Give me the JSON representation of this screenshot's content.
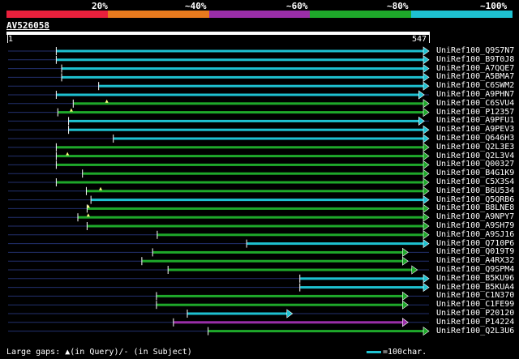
{
  "legend": {
    "segments": [
      "#e8203c",
      "#e87a1e",
      "#9a2ea8",
      "#1ea82a",
      "#1ec1d1"
    ],
    "labels": [
      "20%",
      "~40%",
      "~60%",
      "~80%",
      "~100%"
    ]
  },
  "query": {
    "id": "AV526058",
    "start": "1",
    "end": "547"
  },
  "colors": {
    "green": "#1ea82a",
    "cyan": "#1ec1d1",
    "purple": "#9a2ea8",
    "dim_line": "#23306e",
    "gap_line": "#1e6a86"
  },
  "hits": [
    {
      "name": "UniRef100_Q9S7N7",
      "start": 64,
      "end": 547,
      "color": "cyan"
    },
    {
      "name": "UniRef100_B9T0J8",
      "start": 64,
      "end": 547,
      "color": "cyan"
    },
    {
      "name": "UniRef100_A7QQE7",
      "start": 71,
      "end": 547,
      "color": "cyan"
    },
    {
      "name": "UniRef100_A5BMA7",
      "start": 71,
      "end": 547,
      "color": "cyan"
    },
    {
      "name": "UniRef100_C6SWM2",
      "start": 119,
      "end": 547,
      "color": "cyan"
    },
    {
      "name": "UniRef100_A9PHN7",
      "start": 64,
      "end": 541,
      "color": "cyan"
    },
    {
      "name": "UniRef100_C6SVU4",
      "start": 86,
      "end": 547,
      "color": "green",
      "gap": 129
    },
    {
      "name": "UniRef100_P12357",
      "start": 66,
      "end": 547,
      "color": "green",
      "gap": 83
    },
    {
      "name": "UniRef100_A9PFU1",
      "start": 80,
      "end": 541,
      "color": "cyan"
    },
    {
      "name": "UniRef100_A9PEV3",
      "start": 80,
      "end": 547,
      "color": "cyan"
    },
    {
      "name": "UniRef100_Q646H3",
      "start": 138,
      "end": 547,
      "color": "cyan"
    },
    {
      "name": "UniRef100_Q2L3E3",
      "start": 64,
      "end": 547,
      "color": "green"
    },
    {
      "name": "UniRef100_Q2L3V4",
      "start": 64,
      "end": 547,
      "color": "green",
      "gap": 78
    },
    {
      "name": "UniRef100_Q00327",
      "start": 64,
      "end": 547,
      "color": "green"
    },
    {
      "name": "UniRef100_B4G1K9",
      "start": 98,
      "end": 547,
      "color": "green"
    },
    {
      "name": "UniRef100_C5X3S4",
      "start": 64,
      "end": 547,
      "color": "green"
    },
    {
      "name": "UniRef100_B6U534",
      "start": 103,
      "end": 547,
      "color": "green",
      "gap": 121
    },
    {
      "name": "UniRef100_Q5QRB6",
      "start": 109,
      "end": 547,
      "color": "cyan"
    },
    {
      "name": "UniRef100_B8LNE8",
      "start": 104,
      "end": 547,
      "color": "green",
      "gap": 105
    },
    {
      "name": "UniRef100_A9NPY7",
      "start": 92,
      "end": 547,
      "color": "green",
      "gap": 105
    },
    {
      "name": "UniRef100_A9SH79",
      "start": 104,
      "end": 547,
      "color": "green"
    },
    {
      "name": "UniRef100_A9SJ16",
      "start": 195,
      "end": 547,
      "color": "green"
    },
    {
      "name": "UniRef100_Q710P6",
      "start": 311,
      "end": 547,
      "color": "cyan"
    },
    {
      "name": "UniRef100_Q019T9",
      "start": 189,
      "end": 520,
      "color": "green"
    },
    {
      "name": "UniRef100_A4RX32",
      "start": 175,
      "end": 520,
      "color": "green"
    },
    {
      "name": "UniRef100_Q9SPM4",
      "start": 209,
      "end": 532,
      "color": "green"
    },
    {
      "name": "UniRef100_B5KU96",
      "start": 380,
      "end": 547,
      "color": "cyan"
    },
    {
      "name": "UniRef100_B5KUA4",
      "start": 380,
      "end": 547,
      "color": "cyan"
    },
    {
      "name": "UniRef100_C1N370",
      "start": 194,
      "end": 520,
      "color": "green"
    },
    {
      "name": "UniRef100_C1FE99",
      "start": 194,
      "end": 520,
      "color": "green"
    },
    {
      "name": "UniRef100_P20120",
      "start": 234,
      "end": 370,
      "color": "cyan"
    },
    {
      "name": "UniRef100_P14224",
      "start": 216,
      "end": 520,
      "color": "purple"
    },
    {
      "name": "UniRef100_Q2L3U6",
      "start": 261,
      "end": 547,
      "color": "green"
    }
  ],
  "footer": {
    "left": "Large gaps: ▲(in Query)/- (in Subject)",
    "right": "=100char."
  }
}
